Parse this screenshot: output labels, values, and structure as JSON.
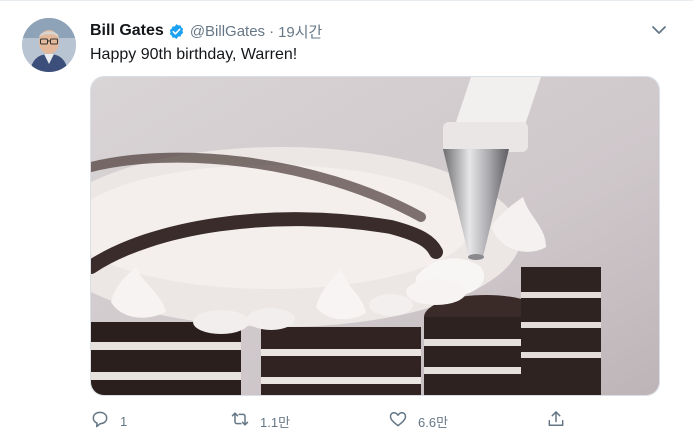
{
  "tweet": {
    "author_name": "Bill Gates",
    "handle": "@BillGates",
    "separator": "·",
    "time": "19시간",
    "text": "Happy 90th birthday, Warren!",
    "media_alt": "Piping white frosting onto an Oreo cookie cake"
  },
  "actions": {
    "reply_count": "1",
    "retweet_count": "1.1만",
    "like_count": "6.6만"
  },
  "colors": {
    "verified": "#1da1f2",
    "secondary_text": "#657786",
    "icon": "#657786"
  },
  "icons": [
    "verified-badge-icon",
    "chevron-down-icon",
    "reply-icon",
    "retweet-icon",
    "like-icon",
    "share-icon"
  ]
}
